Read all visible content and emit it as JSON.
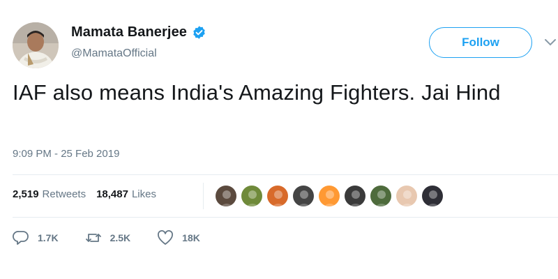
{
  "author": {
    "name": "Mamata Banerjee",
    "handle": "@MamataOfficial",
    "avatar": "profile-photo",
    "verified": true
  },
  "follow_button": {
    "label": "Follow"
  },
  "menu": {
    "icon": "chevron-down-icon"
  },
  "tweet": {
    "text": "IAF also means India's Amazing Fighters. Jai Hind",
    "timestamp": "9:09 PM - 25 Feb 2019"
  },
  "stats": {
    "retweets": {
      "count": "2,519",
      "label": "Retweets"
    },
    "likes": {
      "count": "18,487",
      "label": "Likes"
    }
  },
  "likers": [
    {
      "avatar": "liker-avatar-1",
      "color": "#5b4a3e"
    },
    {
      "avatar": "liker-avatar-2",
      "color": "#6f8a3a"
    },
    {
      "avatar": "liker-avatar-3",
      "color": "#d86a2a"
    },
    {
      "avatar": "liker-avatar-4",
      "color": "#444444"
    },
    {
      "avatar": "liker-avatar-5",
      "color": "#ff9933"
    },
    {
      "avatar": "liker-avatar-6",
      "color": "#3a3a3a"
    },
    {
      "avatar": "liker-avatar-7",
      "color": "#4e6b3c"
    },
    {
      "avatar": "liker-avatar-8",
      "color": "#e8c8b0"
    },
    {
      "avatar": "liker-avatar-9",
      "color": "#2e2e36"
    }
  ],
  "actions": {
    "reply": {
      "icon": "reply-icon",
      "count": "1.7K"
    },
    "retweet": {
      "icon": "retweet-icon",
      "count": "2.5K"
    },
    "like": {
      "icon": "heart-icon",
      "count": "18K"
    }
  },
  "colors": {
    "accent": "#1da1f2",
    "text": "#14171a",
    "muted": "#657786",
    "divider": "#e6ecf0"
  }
}
